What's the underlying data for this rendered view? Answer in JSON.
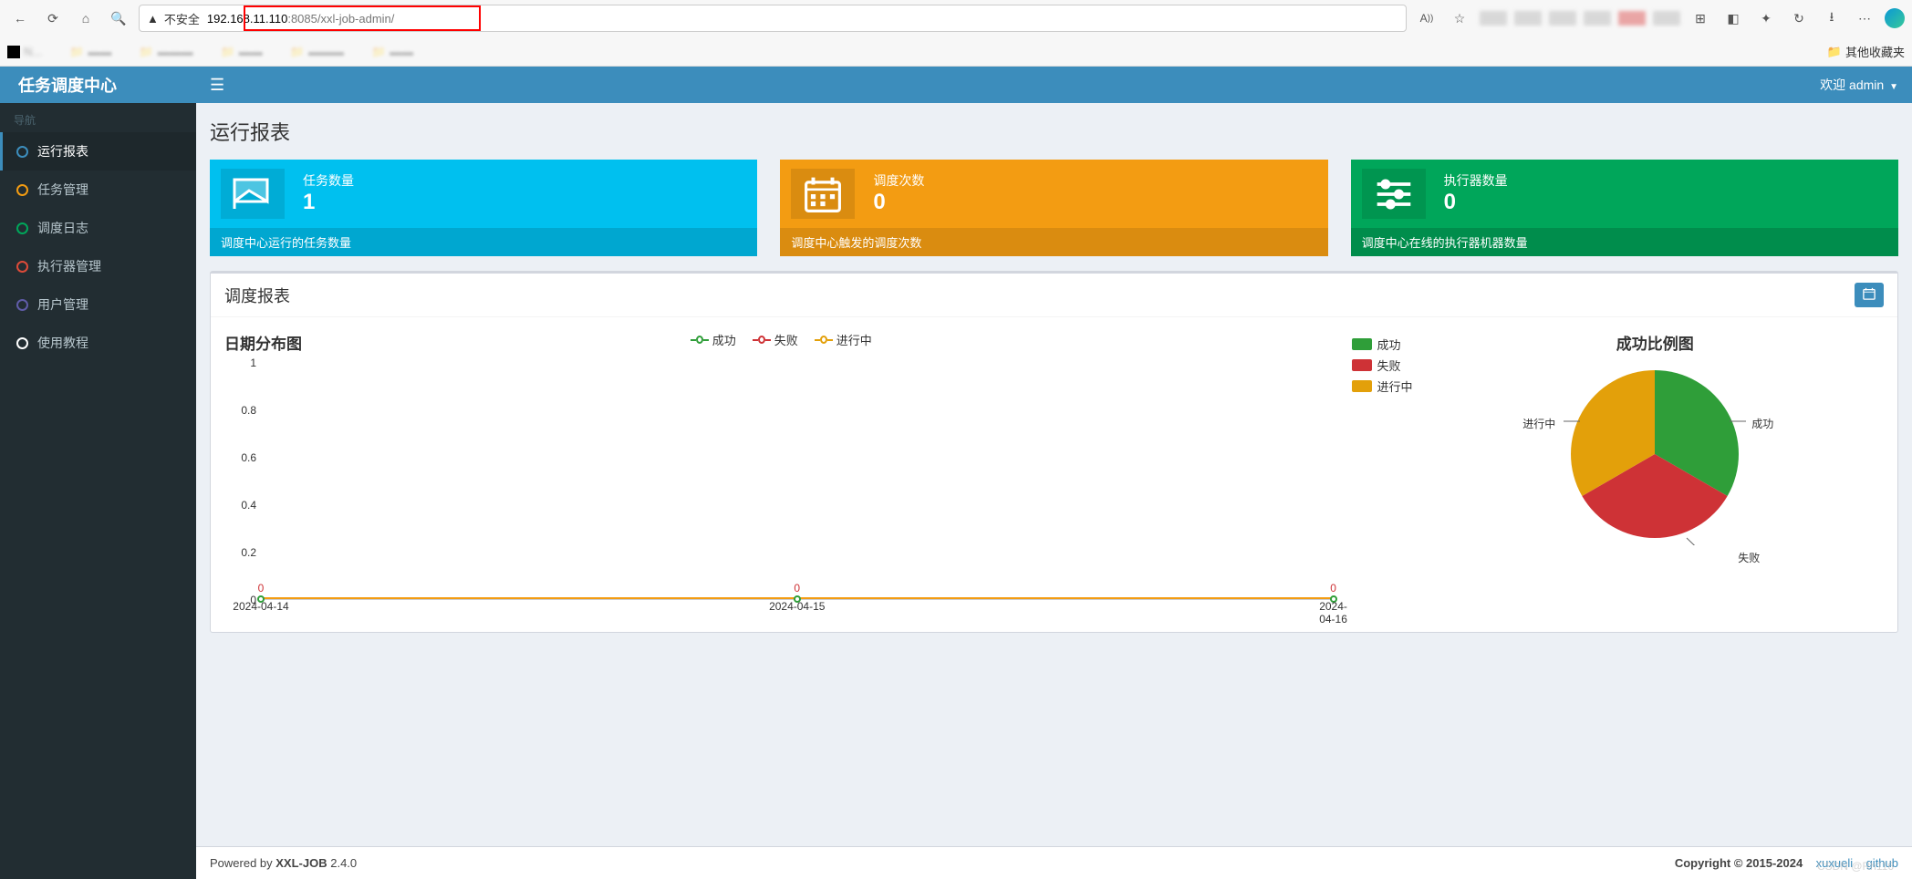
{
  "browser": {
    "security_label": "不安全",
    "url_host": "192.168.11.110",
    "url_port": ":8085",
    "url_path": "/xxl-job-admin/",
    "other_bookmarks": "其他收藏夹"
  },
  "brand": "任务调度中心",
  "nav": {
    "header": "导航",
    "items": [
      {
        "label": "运行报表",
        "active": true,
        "color": "c-blue"
      },
      {
        "label": "任务管理",
        "active": false,
        "color": "c-yellow"
      },
      {
        "label": "调度日志",
        "active": false,
        "color": "c-green"
      },
      {
        "label": "执行器管理",
        "active": false,
        "color": "c-red"
      },
      {
        "label": "用户管理",
        "active": false,
        "color": "c-purple"
      },
      {
        "label": "使用教程",
        "active": false,
        "color": "c-white"
      }
    ]
  },
  "welcome": "欢迎 admin",
  "page_title": "运行报表",
  "cards": [
    {
      "label": "任务数量",
      "value": "1",
      "footer": "调度中心运行的任务数量",
      "cls": "card-blue"
    },
    {
      "label": "调度次数",
      "value": "0",
      "footer": "调度中心触发的调度次数",
      "cls": "card-yellow"
    },
    {
      "label": "执行器数量",
      "value": "0",
      "footer": "调度中心在线的执行器机器数量",
      "cls": "card-green"
    }
  ],
  "box_title": "调度报表",
  "line_chart_title": "日期分布图",
  "line_legend": [
    {
      "label": "成功",
      "color": "#2f9e39"
    },
    {
      "label": "失败",
      "color": "#ce3236"
    },
    {
      "label": "进行中",
      "color": "#e3a00a"
    }
  ],
  "chart_data": {
    "type": "line",
    "categories": [
      "2024-04-14",
      "2024-04-15",
      "2024-04-16"
    ],
    "series": [
      {
        "name": "成功",
        "values": [
          0,
          0,
          0
        ]
      },
      {
        "name": "失败",
        "values": [
          0,
          0,
          0
        ]
      },
      {
        "name": "进行中",
        "values": [
          0,
          0,
          0
        ]
      }
    ],
    "ylim": [
      0,
      1
    ],
    "yticks": [
      0,
      0.2,
      0.4,
      0.6,
      0.8,
      1
    ]
  },
  "pie_title": "成功比例图",
  "pie_legend": [
    {
      "label": "成功",
      "cls": "sw-green"
    },
    {
      "label": "失败",
      "cls": "sw-red"
    },
    {
      "label": "进行中",
      "cls": "sw-yellow"
    }
  ],
  "pie_chart": {
    "type": "pie",
    "slices": [
      {
        "name": "成功",
        "value": 1
      },
      {
        "name": "失败",
        "value": 1
      },
      {
        "name": "进行中",
        "value": 1
      }
    ]
  },
  "pie_labels": {
    "success": "成功",
    "fail": "失败",
    "running": "进行中"
  },
  "footer": {
    "powered_by": "Powered by ",
    "product": "XXL-JOB",
    "version": " 2.4.0",
    "copyright": "Copyright © 2015-2024",
    "link1": "xuxueli",
    "link2": "github"
  },
  "watermark": "CSDN @Rh116"
}
